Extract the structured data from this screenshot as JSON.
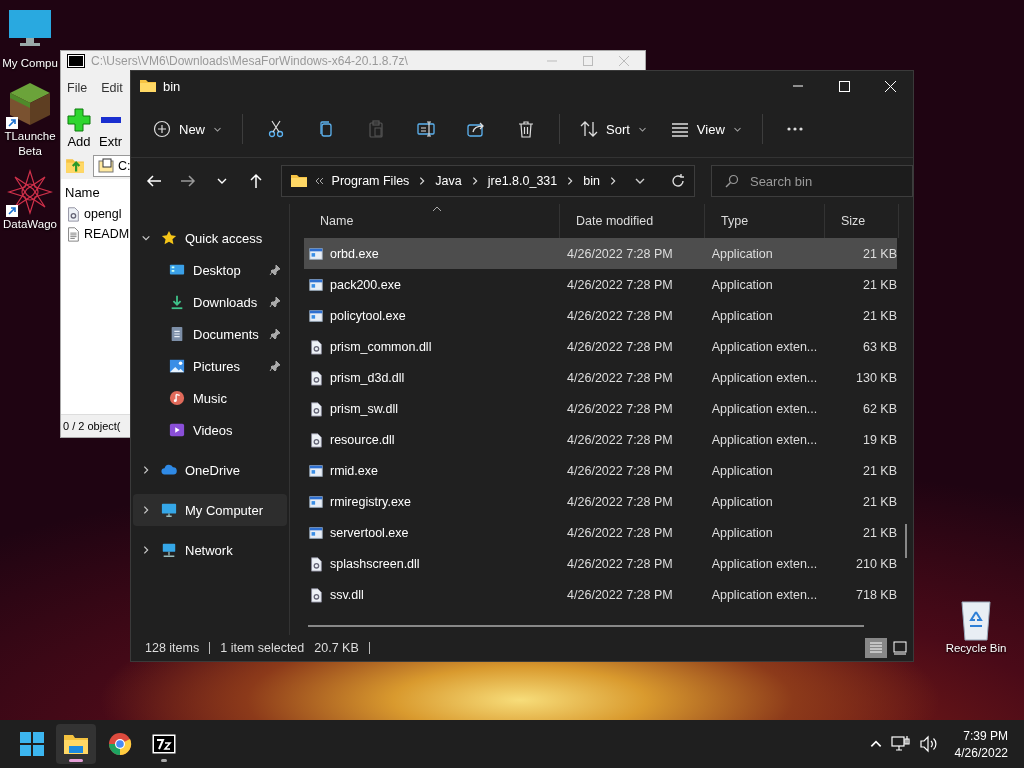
{
  "desktop_icons": [
    {
      "label": "My Compu",
      "kind": "monitor",
      "shortcut": false
    },
    {
      "label": "TLaunche Beta",
      "kind": "grass-block",
      "shortcut": true
    },
    {
      "label": "DataWago",
      "kind": "mandala",
      "shortcut": true
    }
  ],
  "recycle_bin": {
    "label": "Recycle Bin"
  },
  "archive_window": {
    "title": "C:\\Users\\VM6\\Downloads\\MesaForWindows-x64-20.1.8.7z\\",
    "menu": [
      "File",
      "Edit"
    ],
    "toolbar": [
      {
        "kind": "add",
        "label": "Add"
      },
      {
        "kind": "extract",
        "label": "Extr"
      }
    ],
    "address": "C:",
    "column": "Name",
    "files": [
      {
        "kind": "dll",
        "name": "opengl"
      },
      {
        "kind": "text",
        "name": "READM"
      }
    ],
    "status": "0 / 2 object("
  },
  "explorer": {
    "title": "bin",
    "toolbar": [
      {
        "kind": "new",
        "label": "New",
        "disabled": false
      },
      {
        "kind": "cut",
        "disabled": false
      },
      {
        "kind": "copy",
        "disabled": false
      },
      {
        "kind": "paste",
        "disabled": true
      },
      {
        "kind": "rename",
        "disabled": false
      },
      {
        "kind": "share",
        "disabled": false
      },
      {
        "kind": "delete",
        "disabled": false
      },
      {
        "kind": "sort",
        "label": "Sort",
        "disabled": false
      },
      {
        "kind": "view",
        "label": "View",
        "disabled": false
      },
      {
        "kind": "more",
        "disabled": false
      }
    ],
    "breadcrumb": [
      "Program Files",
      "Java",
      "jre1.8.0_331",
      "bin"
    ],
    "search": {
      "placeholder": "Search bin"
    },
    "nav": [
      {
        "label": "Quick access",
        "kind": "star",
        "expanded": true,
        "selected": false,
        "children": [
          {
            "label": "Desktop",
            "kind": "desktop",
            "pinned": true,
            "selected": false
          },
          {
            "label": "Downloads",
            "kind": "download",
            "pinned": true,
            "selected": false
          },
          {
            "label": "Documents",
            "kind": "document",
            "pinned": true,
            "selected": false
          },
          {
            "label": "Pictures",
            "kind": "pictures",
            "pinned": true,
            "selected": false
          },
          {
            "label": "Music",
            "kind": "music",
            "pinned": false,
            "selected": false
          },
          {
            "label": "Videos",
            "kind": "videos",
            "pinned": false,
            "selected": false
          }
        ]
      },
      {
        "label": "OneDrive",
        "kind": "cloud",
        "expanded": false,
        "selected": false
      },
      {
        "label": "My Computer",
        "kind": "computer",
        "expanded": false,
        "selected": true
      },
      {
        "label": "Network",
        "kind": "network",
        "expanded": false,
        "selected": false
      }
    ],
    "columns": [
      "Name",
      "Date modified",
      "Type",
      "Size"
    ],
    "rows": [
      {
        "kind": "exe",
        "name": "orbd.exe",
        "date": "4/26/2022 7:28 PM",
        "type": "Application",
        "size": "21 KB",
        "selected": true
      },
      {
        "kind": "exe",
        "name": "pack200.exe",
        "date": "4/26/2022 7:28 PM",
        "type": "Application",
        "size": "21 KB",
        "selected": false
      },
      {
        "kind": "exe",
        "name": "policytool.exe",
        "date": "4/26/2022 7:28 PM",
        "type": "Application",
        "size": "21 KB",
        "selected": false
      },
      {
        "kind": "dll",
        "name": "prism_common.dll",
        "date": "4/26/2022 7:28 PM",
        "type": "Application exten...",
        "size": "63 KB",
        "selected": false
      },
      {
        "kind": "dll",
        "name": "prism_d3d.dll",
        "date": "4/26/2022 7:28 PM",
        "type": "Application exten...",
        "size": "130 KB",
        "selected": false
      },
      {
        "kind": "dll",
        "name": "prism_sw.dll",
        "date": "4/26/2022 7:28 PM",
        "type": "Application exten...",
        "size": "62 KB",
        "selected": false
      },
      {
        "kind": "dll",
        "name": "resource.dll",
        "date": "4/26/2022 7:28 PM",
        "type": "Application exten...",
        "size": "19 KB",
        "selected": false
      },
      {
        "kind": "exe",
        "name": "rmid.exe",
        "date": "4/26/2022 7:28 PM",
        "type": "Application",
        "size": "21 KB",
        "selected": false
      },
      {
        "kind": "exe",
        "name": "rmiregistry.exe",
        "date": "4/26/2022 7:28 PM",
        "type": "Application",
        "size": "21 KB",
        "selected": false
      },
      {
        "kind": "exe",
        "name": "servertool.exe",
        "date": "4/26/2022 7:28 PM",
        "type": "Application",
        "size": "21 KB",
        "selected": false
      },
      {
        "kind": "dll",
        "name": "splashscreen.dll",
        "date": "4/26/2022 7:28 PM",
        "type": "Application exten...",
        "size": "210 KB",
        "selected": false
      },
      {
        "kind": "dll",
        "name": "ssv.dll",
        "date": "4/26/2022 7:28 PM",
        "type": "Application exten...",
        "size": "718 KB",
        "selected": false
      }
    ],
    "status": [
      "128 items",
      "1 item selected",
      "20.7 KB"
    ],
    "views": [
      {
        "kind": "details",
        "selected": true
      },
      {
        "kind": "tiles",
        "selected": false
      }
    ]
  },
  "taskbar": {
    "apps": [
      {
        "kind": "start",
        "active": false,
        "running": false
      },
      {
        "kind": "file-explorer",
        "active": true,
        "running": true
      },
      {
        "kind": "chrome",
        "active": false,
        "running": false
      },
      {
        "kind": "seven-zip",
        "active": false,
        "running": true
      }
    ],
    "time": "7:39 PM",
    "date": "4/26/2022"
  }
}
